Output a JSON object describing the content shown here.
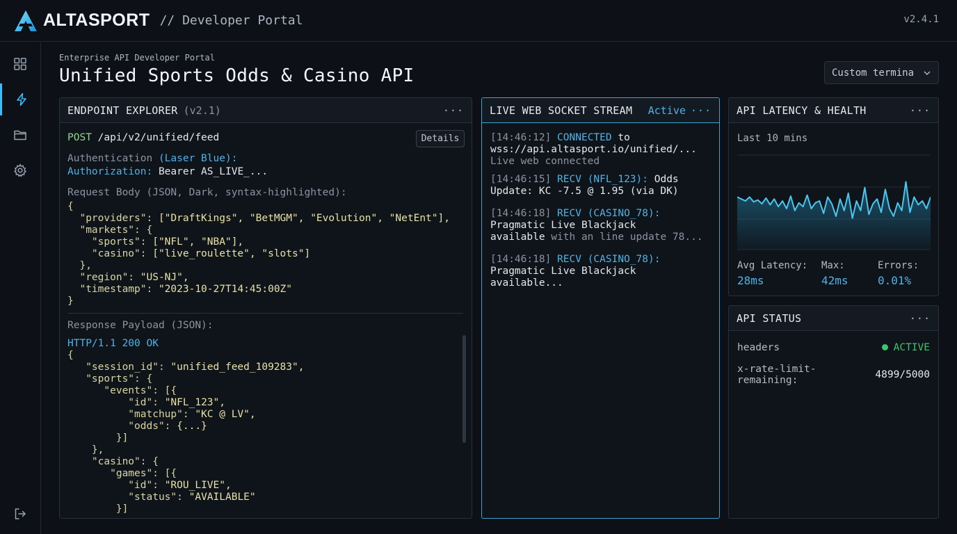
{
  "app": {
    "brand": "ALTASPORT",
    "subtitle": "// Developer Portal",
    "version": "v2.4.1"
  },
  "sidebar": {
    "items": [
      {
        "icon": "grid-icon"
      },
      {
        "icon": "lightning-icon",
        "active": true
      },
      {
        "icon": "folder-icon"
      },
      {
        "icon": "gear-icon"
      }
    ],
    "bottom_icon": "logout-icon"
  },
  "page": {
    "eyebrow": "Enterprise API Developer Portal",
    "title": "Unified Sports Odds & Casino API",
    "dropdown_value": "Custom termina"
  },
  "endpoint": {
    "title": "ENDPOINT EXPLORER",
    "version": "(v2.1)",
    "menu": "···",
    "method": "POST",
    "path": "/api/v2/unified/feed",
    "details_label": "Details",
    "auth_label": "Authentication",
    "auth_note": "(Laser Blue):",
    "auth_header": "Authorization:",
    "auth_value": "Bearer AS_LIVE_...",
    "request_label": "Request Body (JSON, Dark, syntax-highlighted):",
    "request_lines": [
      {
        "k": "{",
        "v": ""
      },
      {
        "k": "  \"providers\": ",
        "v": "[\"DraftKings\", \"BetMGM\", \"Evolution\", \"NetEnt\"],"
      },
      {
        "k": "  \"markets\": {",
        "v": ""
      },
      {
        "k": "    \"sports\": ",
        "v": "[\"NFL\", \"NBA\"],"
      },
      {
        "k": "    \"casino\": ",
        "v": "[\"live_roulette\", \"slots\"]"
      },
      {
        "k": "  },",
        "v": ""
      },
      {
        "k": "  \"region\": ",
        "v": "\"US-NJ\","
      },
      {
        "k": "  \"timestamp\": ",
        "v": "\"2023-10-27T14:45:00Z\""
      },
      {
        "k": "}",
        "v": ""
      }
    ],
    "response_label": "Response Payload (JSON):",
    "response_status": "HTTP/1.1 200 OK",
    "response_lines": [
      {
        "k": "{",
        "v": ""
      },
      {
        "k": "   \"session_id\": ",
        "v": "\"unified_feed_109283\","
      },
      {
        "k": "   \"sports\": {",
        "v": ""
      },
      {
        "k": "      \"events\": [{",
        "v": ""
      },
      {
        "k": "          \"id\": ",
        "v": "\"NFL_123\","
      },
      {
        "k": "          \"matchup\": ",
        "v": "\"KC @ LV\","
      },
      {
        "k": "          \"odds\": ",
        "v": "{...}"
      },
      {
        "k": "        }]",
        "v": ""
      },
      {
        "k": "    },",
        "v": ""
      },
      {
        "k": "    \"casino\": {",
        "v": ""
      },
      {
        "k": "       \"games\": [{",
        "v": ""
      },
      {
        "k": "          \"id\": ",
        "v": "\"ROU_LIVE\","
      },
      {
        "k": "          \"status\": ",
        "v": "\"AVAILABLE\""
      },
      {
        "k": "        }]",
        "v": ""
      }
    ]
  },
  "socket": {
    "title": "LIVE WEB SOCKET STREAM",
    "status": "Active",
    "menu": "···",
    "entries": [
      {
        "time": "[14:46:12]",
        "tag": "CONNECTED",
        "rest": " to",
        "line2": "wss://api.altasport.io/unified/...",
        "line3": "Live web connected"
      },
      {
        "time": "[14:46:15]",
        "tag": "RECV (NFL_123):",
        "rest": " Odds",
        "line2": "Update: KC -7.5 @ 1.95 (via DK)",
        "line3": ""
      },
      {
        "time": "[14:46:18]",
        "tag": "RECV (CASINO_78):",
        "rest": "",
        "line2": "Pragmatic Live Blackjack",
        "line3a": "available",
        "line3b": " with an line update 78..."
      },
      {
        "time": "[14:46:18]",
        "tag": "RECV (CASINO_78):",
        "rest": "",
        "line2": "Pragmatic Live Blackjack available...",
        "line3": ""
      }
    ]
  },
  "latency": {
    "title": "API LATENCY & HEALTH",
    "menu": "···",
    "range_label": "Last 10 mins",
    "avg_label": "Avg Latency:",
    "avg_value": "28ms",
    "max_label": "Max:",
    "max_value": "42ms",
    "errors_label": "Errors:",
    "errors_value": "0.01%",
    "series": [
      62,
      60,
      58,
      62,
      57,
      59,
      55,
      61,
      54,
      60,
      52,
      58,
      50,
      63,
      48,
      56,
      52,
      64,
      50,
      56,
      58,
      45,
      62,
      55,
      42,
      60,
      48,
      66,
      40,
      58,
      48,
      72,
      44,
      55,
      60,
      46,
      70,
      50,
      42,
      56,
      48,
      78,
      46,
      62,
      54,
      58,
      50,
      62
    ]
  },
  "status": {
    "title": "API STATUS",
    "menu": "···",
    "headers_label": "headers",
    "state": "ACTIVE",
    "rate_label": "x-rate-limit-remaining:",
    "rate_value": "4899/5000"
  },
  "colors": {
    "accent": "#38bdf8",
    "active_green": "#3ec46d"
  }
}
